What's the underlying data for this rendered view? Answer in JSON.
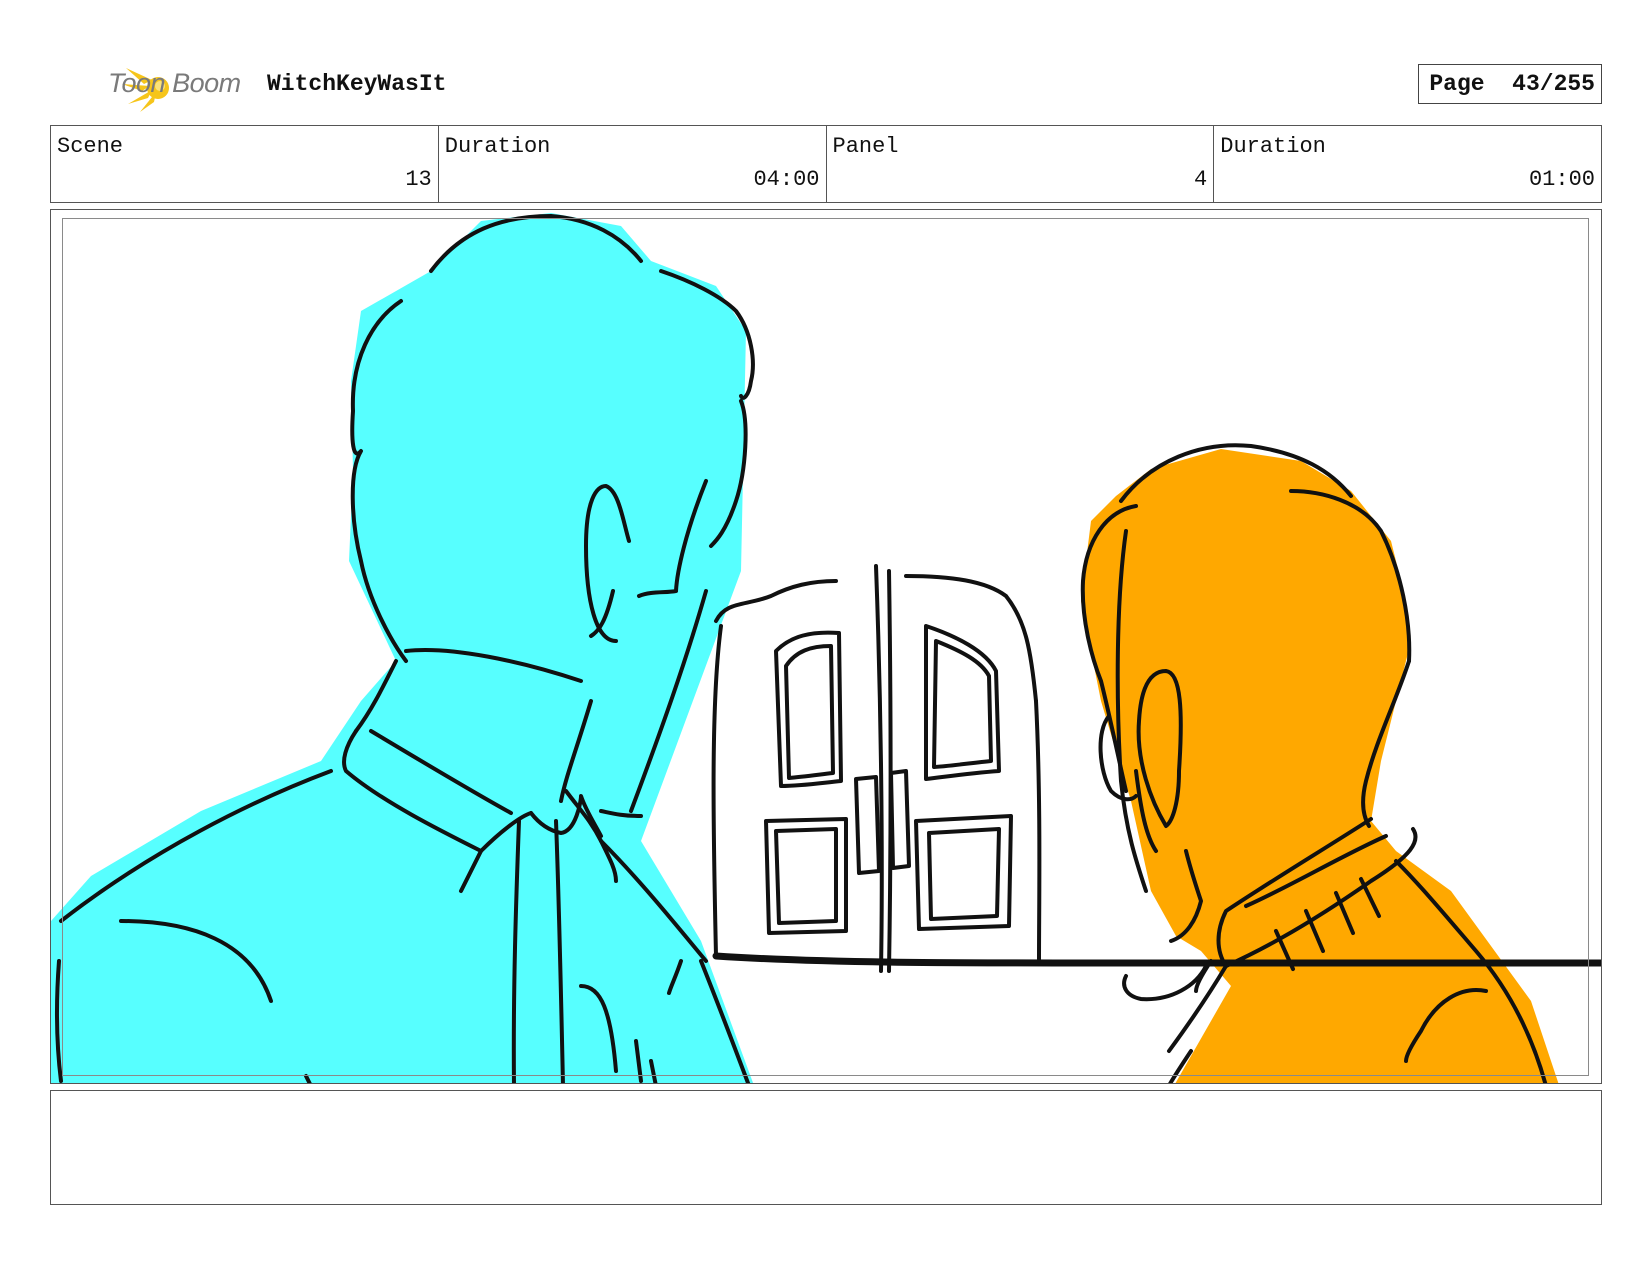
{
  "header": {
    "brand": "Toon Boom",
    "project_title": "WitchKeyWasIt",
    "page_label": "Page",
    "page_number": "43/255"
  },
  "info": {
    "scene_label": "Scene",
    "scene_value": "13",
    "scene_duration_label": "Duration",
    "scene_duration_value": "04:00",
    "panel_label": "Panel",
    "panel_value": "4",
    "panel_duration_label": "Duration",
    "panel_duration_value": "01:00"
  },
  "colors": {
    "character_left": "#57ffff",
    "character_right": "#ffa800",
    "ink": "#111111",
    "logo_yellow": "#f6c51b"
  },
  "notes": {
    "dialogue": ""
  }
}
